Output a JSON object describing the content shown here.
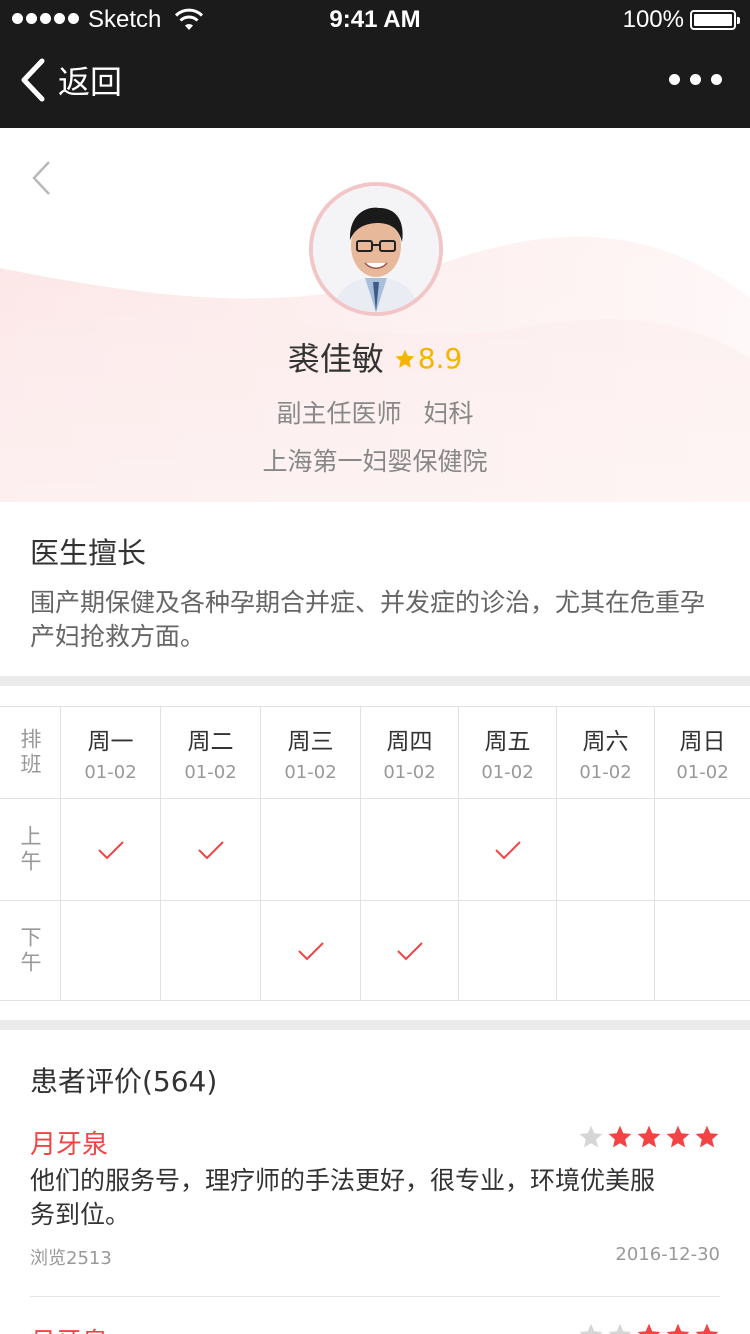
{
  "status_bar": {
    "carrier": "Sketch",
    "time": "9:41 AM",
    "battery": "100%"
  },
  "nav": {
    "back_label": "返回"
  },
  "doctor": {
    "name": "裘佳敏",
    "rating": "8.9",
    "title": "副主任医师",
    "department": "妇科",
    "hospital": "上海第一妇婴保健院"
  },
  "expertise": {
    "heading": "医生擅长",
    "text": "围产期保健及各种孕期合并症、并发症的诊治，尤其在危重孕产妇抢救方面。"
  },
  "schedule": {
    "header_label": "排班",
    "days": [
      {
        "name": "周一",
        "date": "01-02"
      },
      {
        "name": "周二",
        "date": "01-02"
      },
      {
        "name": "周三",
        "date": "01-02"
      },
      {
        "name": "周四",
        "date": "01-02"
      },
      {
        "name": "周五",
        "date": "01-02"
      },
      {
        "name": "周六",
        "date": "01-02"
      },
      {
        "name": "周日",
        "date": "01-02"
      }
    ],
    "rows": [
      {
        "label": "上午",
        "slots": [
          true,
          true,
          false,
          false,
          true,
          false,
          false
        ]
      },
      {
        "label": "下午",
        "slots": [
          false,
          false,
          true,
          true,
          false,
          false,
          false
        ]
      }
    ]
  },
  "reviews": {
    "heading": "患者评价(564)",
    "items": [
      {
        "reviewer": "月牙泉",
        "stars": 4,
        "text": "他们的服务号，理疗师的手法更好，很专业，环境优美服务到位。",
        "views": "浏览2513",
        "date": "2016-12-30"
      },
      {
        "reviewer": "月牙泉",
        "stars": 3,
        "text": "",
        "views": "",
        "date": ""
      }
    ]
  },
  "colors": {
    "nav_bg": "#1b1b1b",
    "accent_red": "#f24444",
    "rating_gold": "#f5b400",
    "star_empty": "#d6d6d6"
  }
}
